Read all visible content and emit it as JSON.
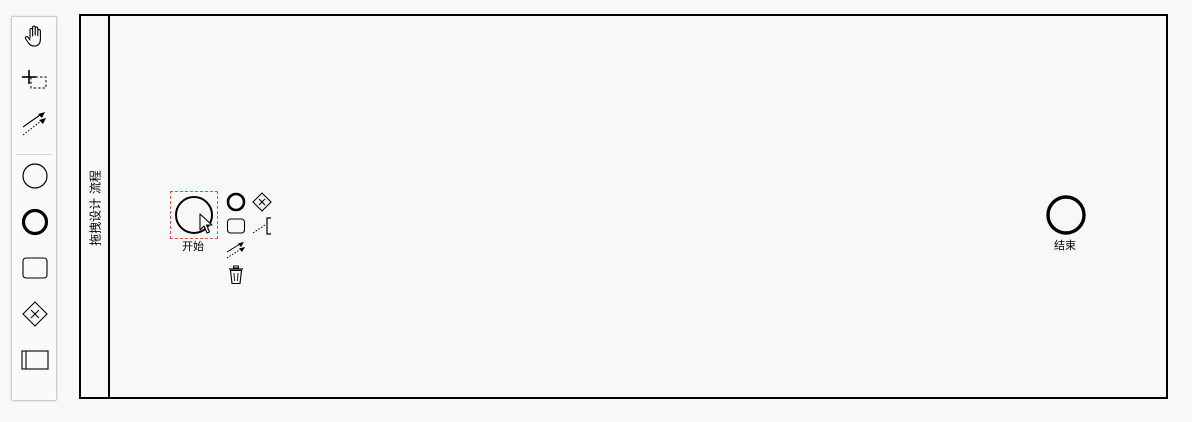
{
  "palette": {
    "tools": [
      {
        "name": "hand-tool",
        "icon": "hand-icon"
      },
      {
        "name": "lasso-tool",
        "icon": "lasso-icon"
      },
      {
        "name": "global-connect-tool",
        "icon": "connect-icon"
      }
    ],
    "shapes": [
      {
        "name": "create-start-event",
        "icon": "start-event-icon"
      },
      {
        "name": "create-end-event",
        "icon": "end-event-icon"
      },
      {
        "name": "create-task",
        "icon": "task-icon"
      },
      {
        "name": "create-gateway",
        "icon": "gateway-icon"
      },
      {
        "name": "create-pool",
        "icon": "participant-icon"
      }
    ]
  },
  "pool": {
    "label": "拖拽设计 流程"
  },
  "start_event": {
    "label": "开始"
  },
  "end_event": {
    "label": "结束"
  },
  "context_pad": {
    "entries": [
      {
        "name": "append-end-event",
        "icon": "end-event-icon"
      },
      {
        "name": "append-gateway",
        "icon": "gateway-icon"
      },
      {
        "name": "append-task",
        "icon": "task-icon"
      },
      {
        "name": "append-text-annotation",
        "icon": "text-annotation-icon"
      },
      {
        "name": "connect",
        "icon": "connect-icon"
      },
      {
        "name": "delete",
        "icon": "trash-icon"
      }
    ]
  },
  "colors": {
    "selection_outline": "#e05050",
    "stroke": "#000000",
    "canvas_bg": "#f8f8f8",
    "palette_bg": "#fafafa"
  }
}
